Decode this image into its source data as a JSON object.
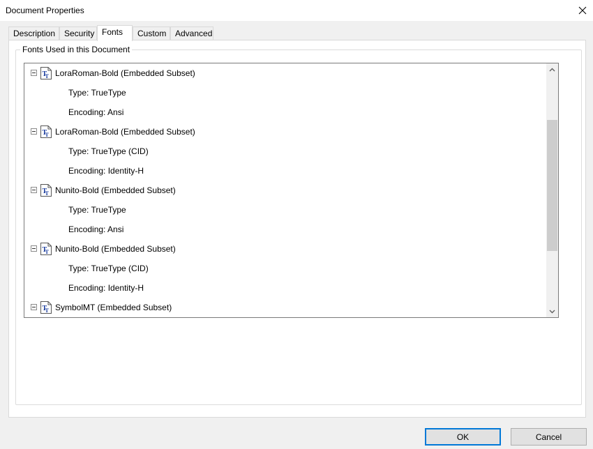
{
  "window": {
    "title": "Document Properties"
  },
  "tabs": [
    {
      "label": "Description",
      "active": false
    },
    {
      "label": "Security",
      "active": false
    },
    {
      "label": "Fonts",
      "active": true
    },
    {
      "label": "Custom",
      "active": false
    },
    {
      "label": "Advanced",
      "active": false
    }
  ],
  "fonts_group": {
    "legend": "Fonts Used in this Document",
    "fonts": [
      {
        "name": "LoraRoman-Bold (Embedded Subset)",
        "type": "Type: TrueType",
        "encoding": "Encoding: Ansi"
      },
      {
        "name": "LoraRoman-Bold (Embedded Subset)",
        "type": "Type: TrueType (CID)",
        "encoding": "Encoding: Identity-H"
      },
      {
        "name": "Nunito-Bold (Embedded Subset)",
        "type": "Type: TrueType",
        "encoding": "Encoding: Ansi"
      },
      {
        "name": "Nunito-Bold (Embedded Subset)",
        "type": "Type: TrueType (CID)",
        "encoding": "Encoding: Identity-H"
      },
      {
        "name": "SymbolMT (Embedded Subset)"
      }
    ]
  },
  "buttons": {
    "ok": "OK",
    "cancel": "Cancel"
  },
  "scrollbar": {
    "scroll_position": 0.45
  },
  "icons": {
    "close": "close-icon",
    "expander": "collapse-minus-icon",
    "font": "truetype-font-icon",
    "scroll_up": "chevron-up-icon",
    "scroll_down": "chevron-down-icon"
  },
  "colors": {
    "accent": "#0078d7",
    "font_icon_blue": "#1a3c9e"
  }
}
